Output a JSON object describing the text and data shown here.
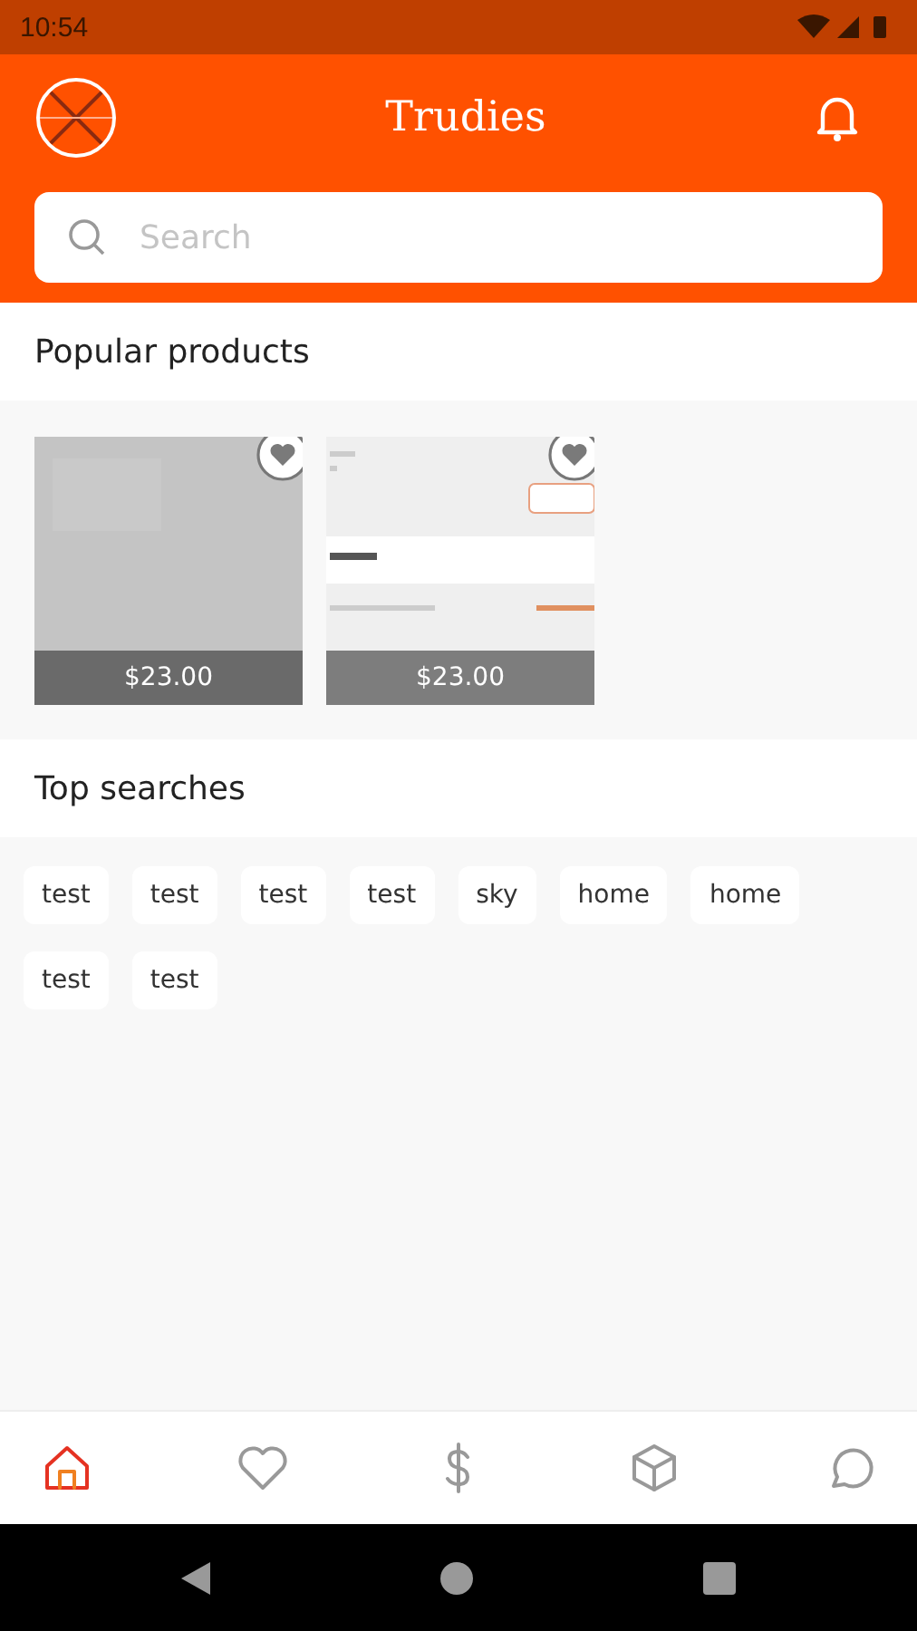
{
  "status_bar": {
    "time": "10:54"
  },
  "header": {
    "title": "Trudies"
  },
  "search": {
    "placeholder": "Search"
  },
  "popular": {
    "title": "Popular products",
    "products": [
      {
        "price": "$23.00",
        "favorite": false
      },
      {
        "price": "$23.00",
        "favorite": false
      }
    ]
  },
  "top_searches": {
    "title": "Top searches",
    "tags": [
      "test",
      "test",
      "test",
      "test",
      "sky",
      "home",
      "home",
      "test",
      "test"
    ]
  },
  "bottom_nav": [
    {
      "selected": true
    },
    {
      "selected": false
    },
    {
      "selected": false
    },
    {
      "selected": false
    },
    {
      "selected": false
    }
  ]
}
